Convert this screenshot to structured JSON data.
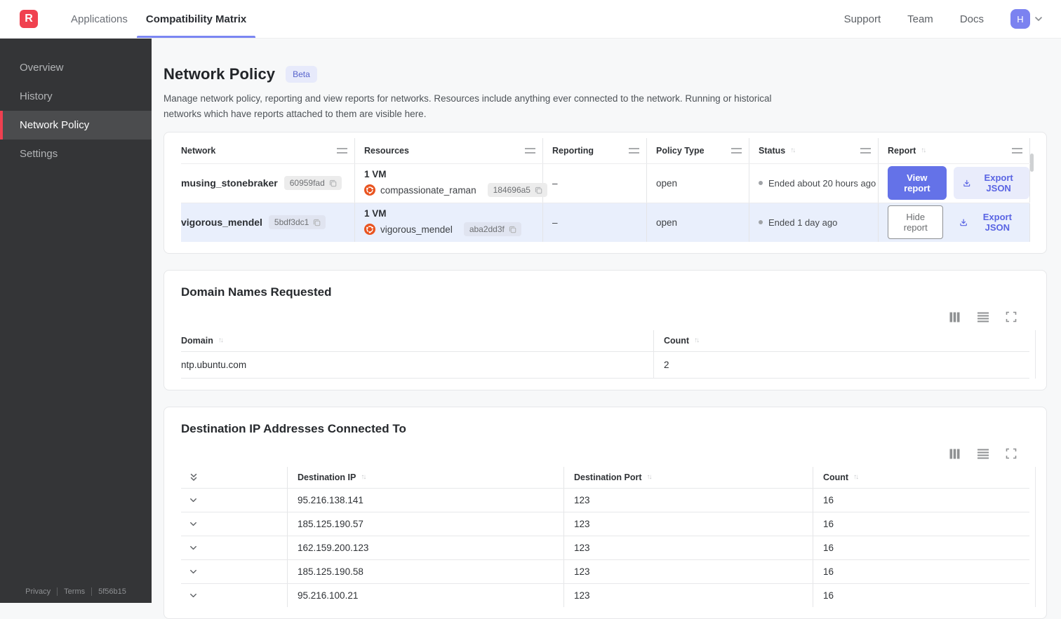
{
  "nav": {
    "logo_letter": "R",
    "tabs": [
      {
        "label": "Applications"
      },
      {
        "label": "Compatibility Matrix"
      }
    ],
    "links": [
      {
        "label": "Support"
      },
      {
        "label": "Team"
      },
      {
        "label": "Docs"
      }
    ],
    "avatar_initial": "H"
  },
  "sidebar": {
    "items": [
      {
        "label": "Overview"
      },
      {
        "label": "History"
      },
      {
        "label": "Network Policy"
      },
      {
        "label": "Settings"
      }
    ],
    "footer": {
      "privacy": "Privacy",
      "terms": "Terms",
      "version": "5f56b15"
    }
  },
  "page": {
    "title": "Network Policy",
    "badge": "Beta",
    "description": "Manage network policy, reporting and view reports for networks. Resources include anything ever connected to the network. Running or historical networks which have reports attached to them are visible here."
  },
  "networks_table": {
    "columns": [
      {
        "label": "Network"
      },
      {
        "label": "Resources"
      },
      {
        "label": "Reporting"
      },
      {
        "label": "Policy Type"
      },
      {
        "label": "Status"
      },
      {
        "label": "Report"
      }
    ],
    "rows": [
      {
        "network_name": "musing_stonebraker",
        "network_id": "60959fad",
        "resources_summary": "1 VM",
        "resource_name": "compassionate_raman",
        "resource_id": "184696a5",
        "resource_os": "ubuntu",
        "reporting": "–",
        "policy_type": "open",
        "status": "Ended about 20 hours ago",
        "report_button": "View report",
        "export_button": "Export JSON"
      },
      {
        "network_name": "vigorous_mendel",
        "network_id": "5bdf3dc1",
        "resources_summary": "1 VM",
        "resource_name": "vigorous_mendel",
        "resource_id": "aba2dd3f",
        "resource_os": "ubuntu",
        "reporting": "–",
        "policy_type": "open",
        "status": "Ended 1 day ago",
        "report_button": "Hide report",
        "export_button": "Export JSON"
      }
    ]
  },
  "domains_card": {
    "title": "Domain Names Requested",
    "toolbar_icons": [
      "columns-icon",
      "rows-icon",
      "expand-icon"
    ],
    "columns": [
      {
        "label": "Domain"
      },
      {
        "label": "Count"
      }
    ],
    "rows": [
      {
        "domain": "ntp.ubuntu.com",
        "count": "2"
      }
    ]
  },
  "destinations_card": {
    "title": "Destination IP Addresses Connected To",
    "toolbar_icons": [
      "columns-icon",
      "rows-icon",
      "expand-icon"
    ],
    "columns": [
      {
        "label": "Destination IP"
      },
      {
        "label": "Destination Port"
      },
      {
        "label": "Count"
      }
    ],
    "rows": [
      {
        "ip": "95.216.138.141",
        "port": "123",
        "count": "16"
      },
      {
        "ip": "185.125.190.57",
        "port": "123",
        "count": "16"
      },
      {
        "ip": "162.159.200.123",
        "port": "123",
        "count": "16"
      },
      {
        "ip": "185.125.190.58",
        "port": "123",
        "count": "16"
      },
      {
        "ip": "95.216.100.21",
        "port": "123",
        "count": "16"
      }
    ]
  },
  "colors": {
    "brand_red": "#f0414f",
    "accent_purple": "#6472e8",
    "tab_underline": "#7b86f2",
    "selected_row": "#e9effc",
    "ubuntu_orange": "#e95420",
    "sidebar_bg": "#343537"
  }
}
